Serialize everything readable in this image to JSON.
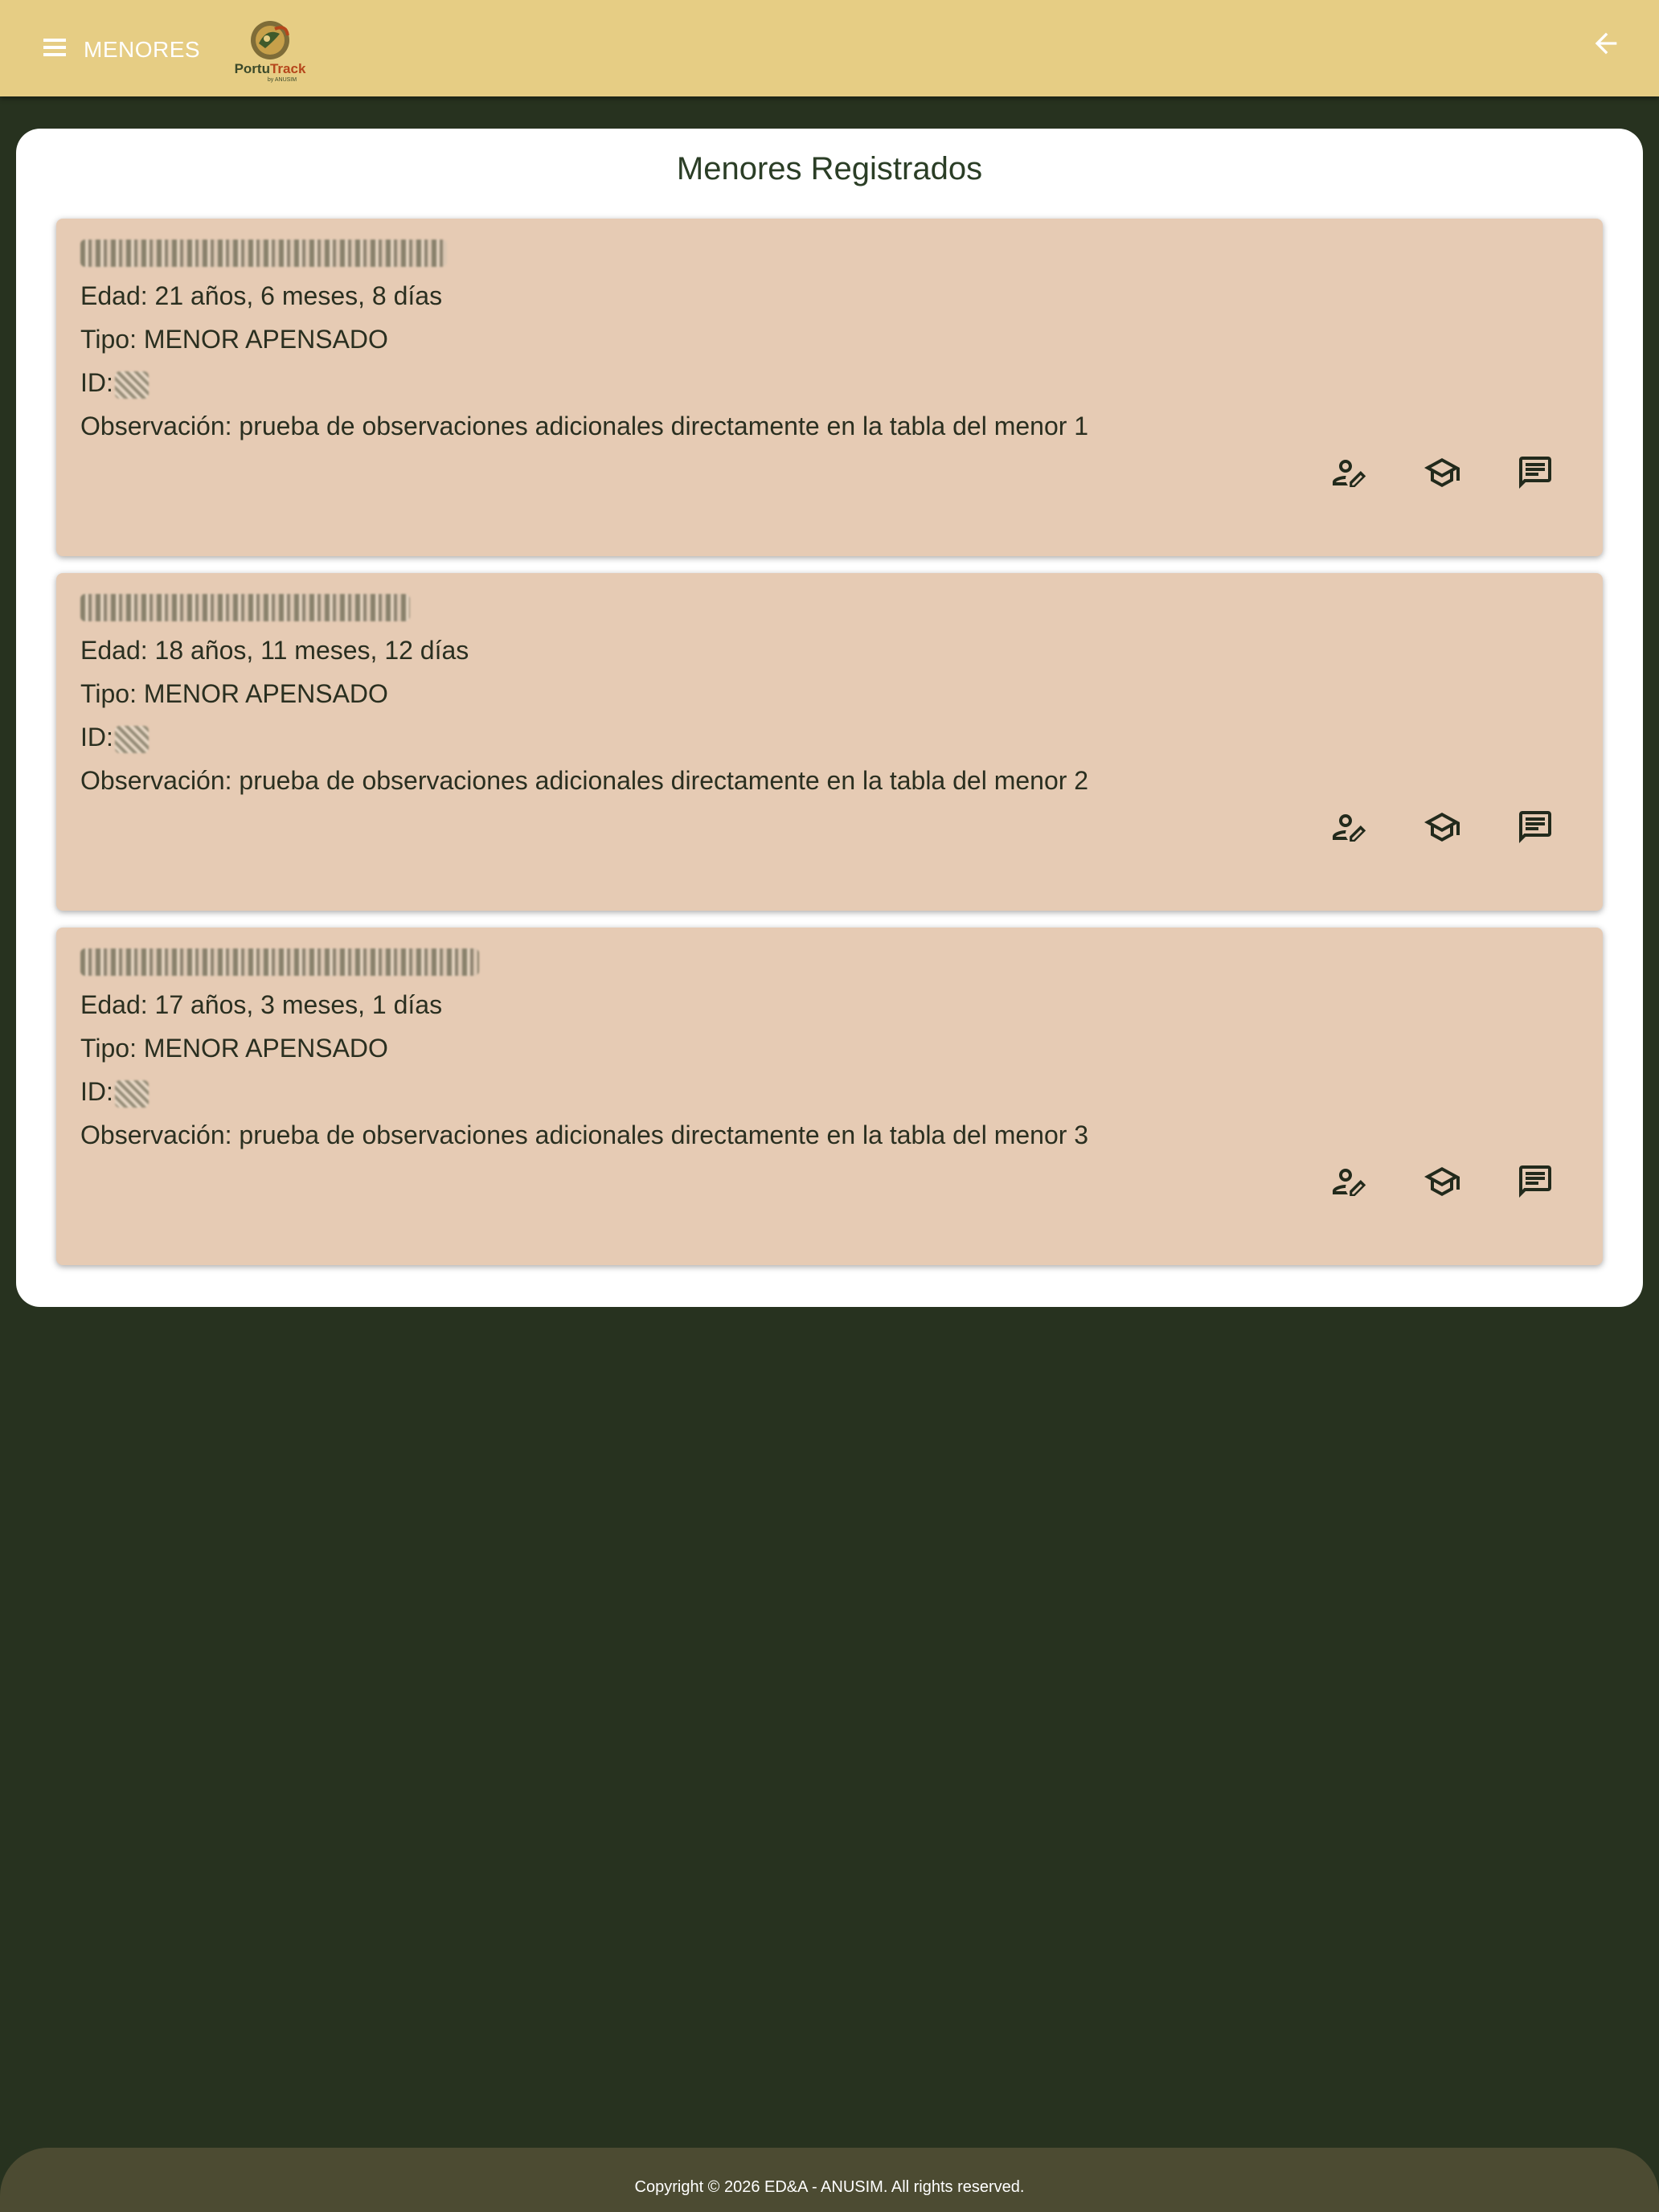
{
  "header": {
    "menu_title": "MENORES",
    "logo_text_a": "Portu",
    "logo_text_b": "Track",
    "logo_sub": "by ANUSIM",
    "bg_color": "#e6cd84"
  },
  "panel": {
    "title": "Menores Registrados"
  },
  "cards": [
    {
      "name": "████████ ███████ ███",
      "edad": "Edad: 21 años, 6 meses, 8 días",
      "tipo": "Tipo: MENOR APENSADO",
      "id_label": "ID:",
      "observacion": "Observación: prueba de observaciones adicionales directamente en la tabla del menor 1"
    },
    {
      "name": "██████ ████████",
      "edad": "Edad: 18 años, 11 meses, 12 días",
      "tipo": "Tipo: MENOR APENSADO",
      "id_label": "ID:",
      "observacion": "Observación: prueba de observaciones adicionales directamente en la tabla del menor 2"
    },
    {
      "name": "███████ █████████ ████",
      "edad": "Edad: 17 años, 3 meses, 1 días",
      "tipo": "Tipo: MENOR APENSADO",
      "id_label": "ID:",
      "observacion": "Observación: prueba de observaciones adicionales directamente en la tabla del menor 3"
    }
  ],
  "actions": {
    "edit_icon": "person-edit-icon",
    "education_icon": "graduation-cap-icon",
    "comment_icon": "comment-icon"
  },
  "footer": {
    "copyright": "Copyright © 2026 ED&A - ANUSIM. All rights reserved."
  }
}
